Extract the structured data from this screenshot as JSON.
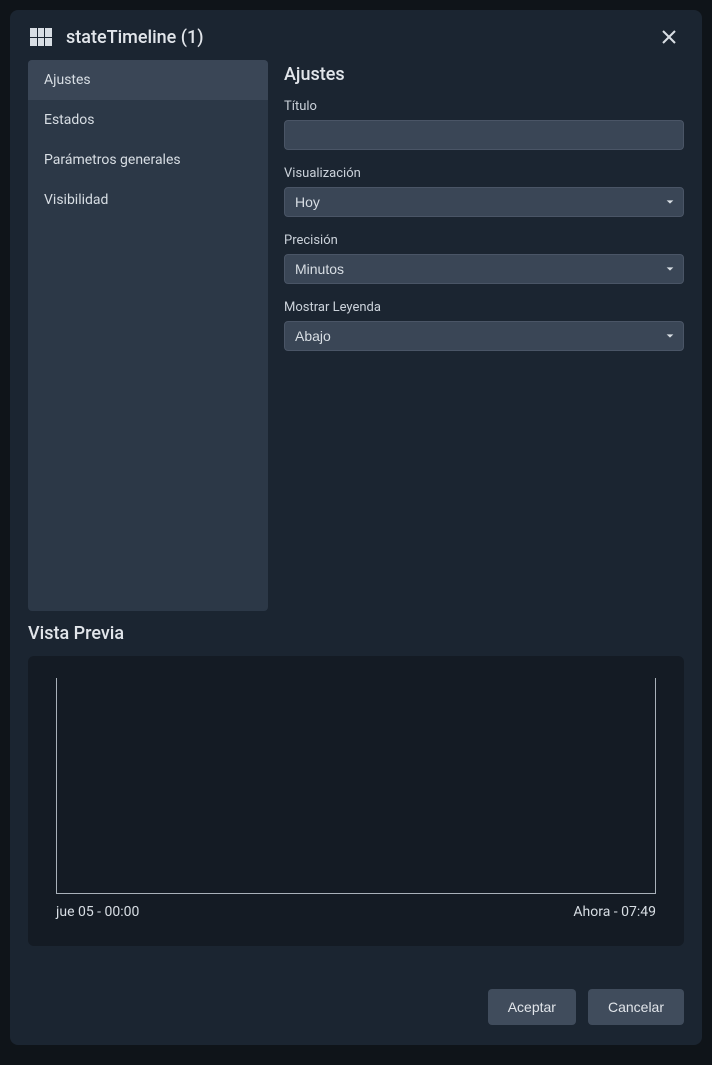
{
  "header": {
    "title": "stateTimeline (1)"
  },
  "sidebar": {
    "items": [
      {
        "label": "Ajustes",
        "active": true
      },
      {
        "label": "Estados",
        "active": false
      },
      {
        "label": "Parámetros generales",
        "active": false
      },
      {
        "label": "Visibilidad",
        "active": false
      }
    ]
  },
  "panel": {
    "title": "Ajustes",
    "fields": {
      "titulo": {
        "label": "Título",
        "value": ""
      },
      "visualizacion": {
        "label": "Visualización",
        "value": "Hoy"
      },
      "precision": {
        "label": "Precisión",
        "value": "Minutos"
      },
      "leyenda": {
        "label": "Mostrar Leyenda",
        "value": "Abajo"
      }
    }
  },
  "preview": {
    "title": "Vista Previa",
    "start_label": "jue 05 - 00:00",
    "end_label": "Ahora - 07:49"
  },
  "footer": {
    "accept": "Aceptar",
    "cancel": "Cancelar"
  },
  "chart_data": {
    "type": "bar",
    "title": "",
    "xlabel": "",
    "ylabel": "",
    "categories": [],
    "values": [],
    "x_start": "jue 05 - 00:00",
    "x_end": "Ahora - 07:49"
  }
}
